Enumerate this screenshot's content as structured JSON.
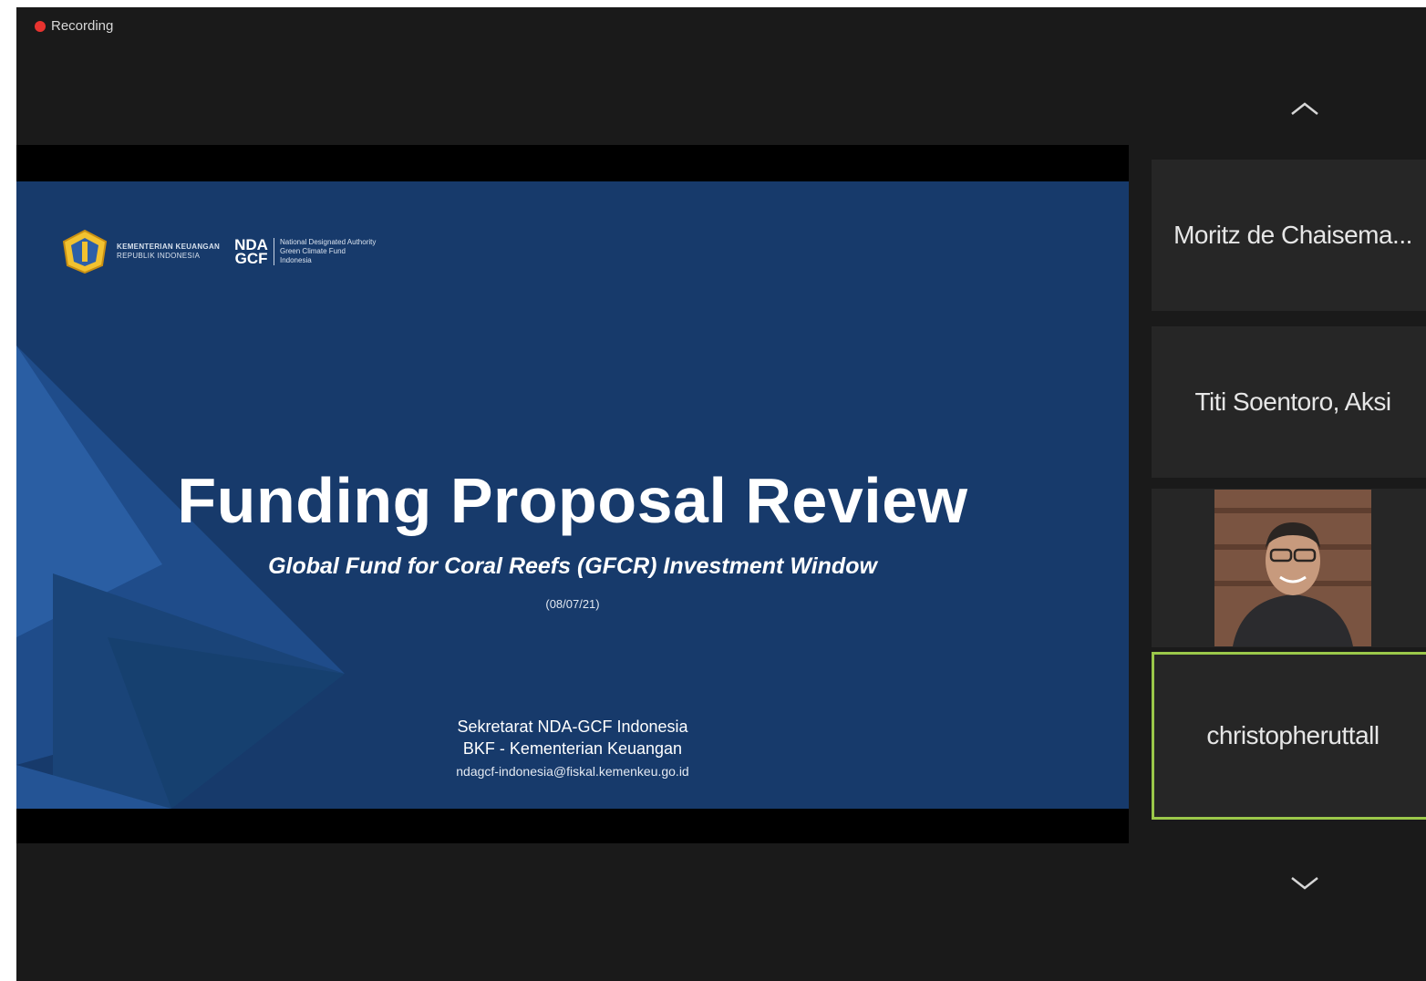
{
  "recording": {
    "label": "Recording",
    "color": "#e8332f"
  },
  "slide": {
    "ministry_line1": "KEMENTERIAN KEUANGAN",
    "ministry_line2": "REPUBLIK INDONESIA",
    "nda_line1": "NDA",
    "nda_line2": "GCF",
    "nda_desc1": "National Designated Authority",
    "nda_desc2": "Green Climate Fund",
    "nda_desc3": "Indonesia",
    "title": "Funding Proposal Review",
    "subtitle": "Global Fund for Coral Reefs (GFCR) Investment Window",
    "date": "(08/07/21)",
    "footer_line1": "Sekretarat NDA-GCF Indonesia",
    "footer_line2": "BKF - Kementerian Keuangan",
    "footer_email": "ndagcf-indonesia@fiskal.kemenkeu.go.id",
    "background_color": "#173a6b"
  },
  "participants": [
    {
      "name": "Moritz de Chaisema...",
      "video": false,
      "active": false
    },
    {
      "name": "Titi Soentoro, Aksi",
      "video": false,
      "active": false
    },
    {
      "name": "",
      "video": true,
      "active": false
    },
    {
      "name": "christopheruttall",
      "video": false,
      "active": true
    }
  ],
  "controls": {
    "scroll_up_icon": "chevron-up-icon",
    "scroll_down_icon": "chevron-down-icon"
  },
  "colors": {
    "active_speaker_border": "#9bc84a",
    "tile_bg": "#262626",
    "window_bg": "#1a1a1a"
  }
}
